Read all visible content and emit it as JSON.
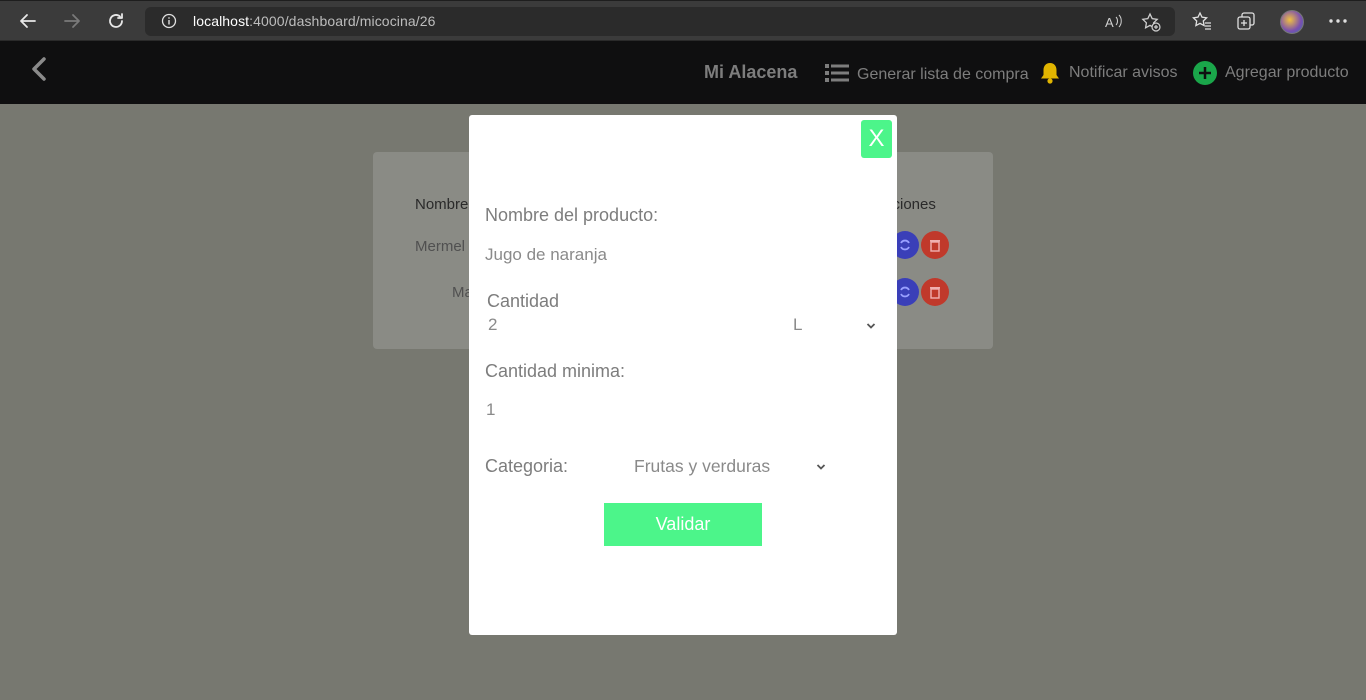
{
  "browser": {
    "url_host": "localhost",
    "url_path": ":4000/dashboard/micocina/26"
  },
  "header": {
    "title": "Mi Alacena",
    "shopping_list": "Generar lista de compra",
    "notify": "Notificar avisos",
    "add_product": "Agregar producto"
  },
  "background_table": {
    "col_name": "Nombre",
    "col_actions": "cciones",
    "rows": [
      {
        "name": "Mermel"
      },
      {
        "name": "Ma"
      }
    ]
  },
  "modal": {
    "close": "X",
    "name_label": "Nombre del producto:",
    "name_value": "Jugo de naranja",
    "qty_label": "Cantidad",
    "qty_value": "2",
    "unit_value": "L",
    "min_label": "Cantidad minima:",
    "min_value": "1",
    "category_label": "Categoria:",
    "category_value": "Frutas y verduras",
    "submit": "Validar"
  },
  "colors": {
    "accent": "#4cf58a",
    "refresh_button": "#3a3fb8",
    "delete_button": "#c0392b",
    "bell": "#e0b400",
    "add_icon": "#1aa64a"
  }
}
